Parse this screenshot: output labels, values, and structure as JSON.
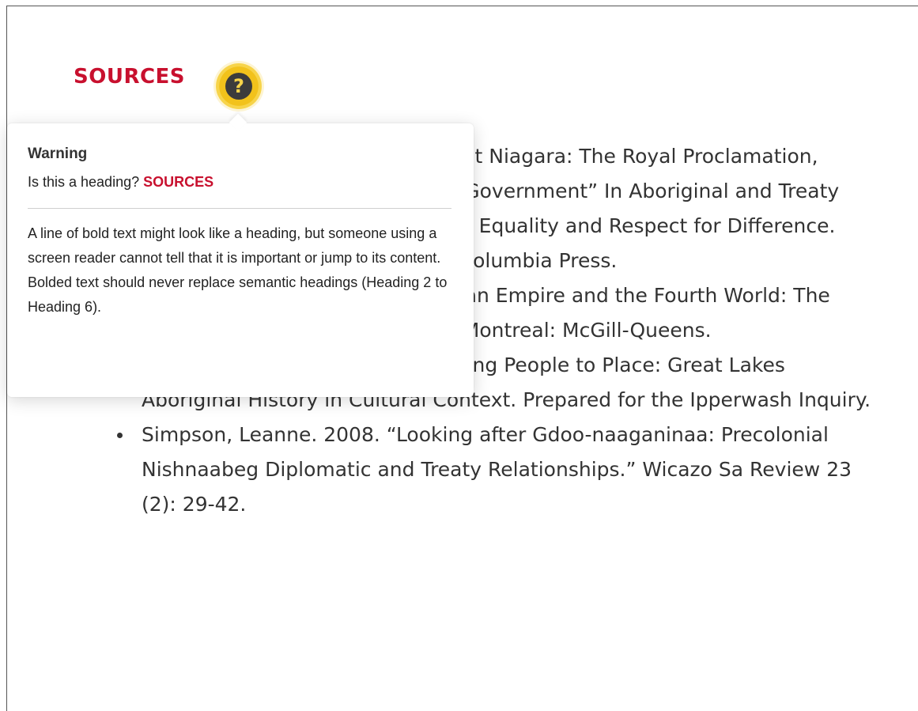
{
  "section": {
    "heading": "SOURCES",
    "help_icon": "question-mark-icon"
  },
  "references": [
    "Borrows, John. 1997. “Wampum at Niagara: The Royal Proclamation, Canadian Legal History and Self-Government” In Aboriginal and Treaty Rights in Canada: Essays on Law, Equality and Respect for Difference. Vancouver: University of British Columbia Press.",
    "Borrows, John. 2010. The American Empire and the Fourth World: The Bowl with One Spoon, Part One. Montreal: McGill-Queens.",
    "Johnson, Darlene. 2005. Connecting People to Place: Great Lakes Aboriginal History in Cultural Context. Prepared for the Ipperwash Inquiry.",
    "Simpson, Leanne. 2008. “Looking after Gdoo-naaganinaa: Precolonial Nishnaabeg Diplomatic and Treaty Relationships.” Wicazo Sa Review 23 (2): 29-42."
  ],
  "tooltip": {
    "title": "Warning",
    "question_label": "Is this a heading?",
    "question_value": "SOURCES",
    "body": "A line of bold text might look like a heading, but someone using a screen reader cannot tell that it is important or jump to its content. Bolded text should never replace semantic headings (Heading 2 to Heading 6)."
  },
  "colors": {
    "accent_red": "#c8102e",
    "badge_yellow": "#f2c21b"
  }
}
